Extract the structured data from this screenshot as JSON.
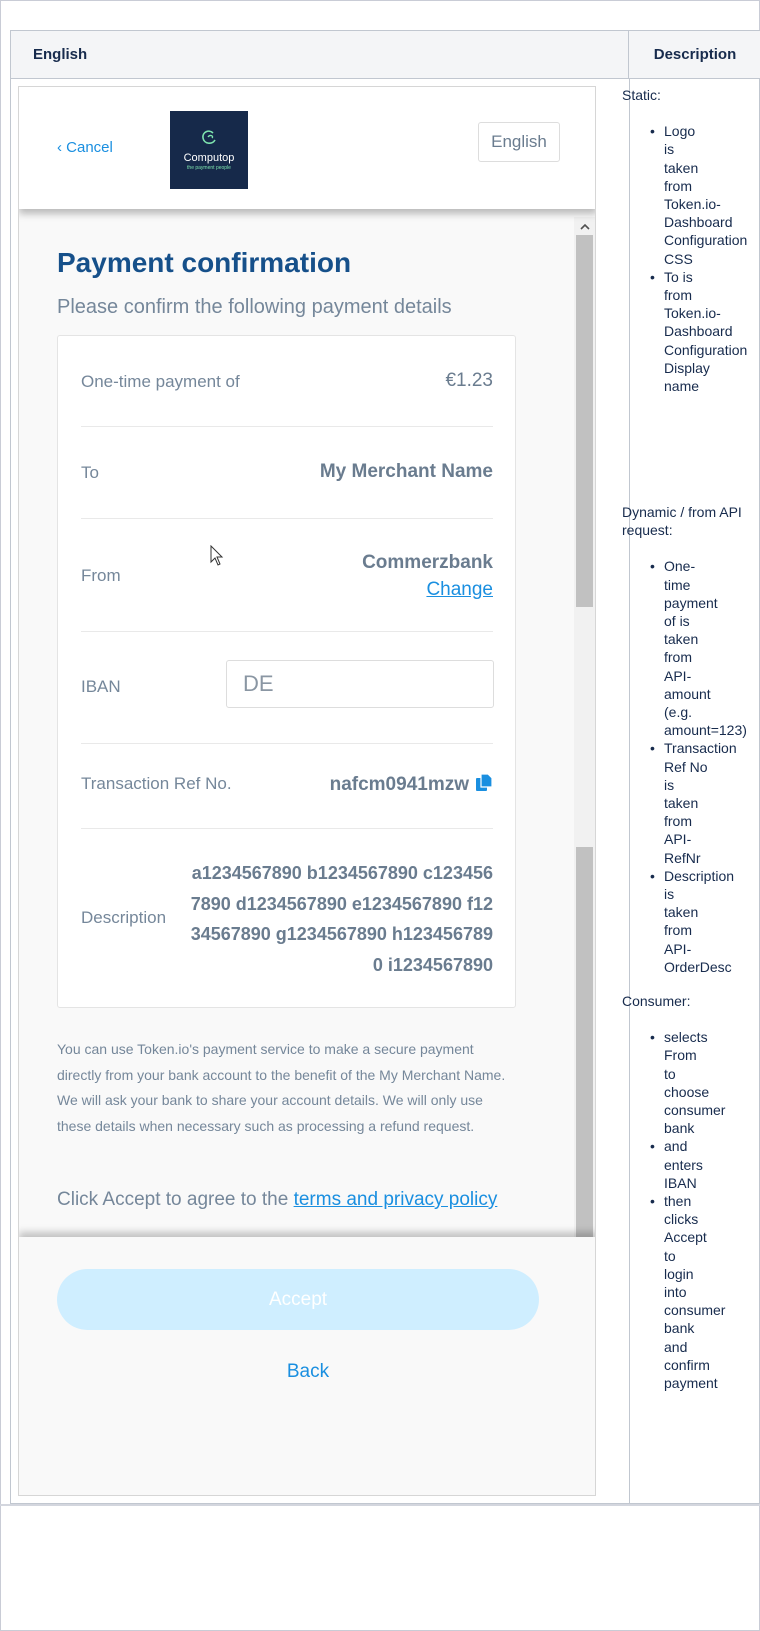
{
  "table": {
    "col1_header": "English",
    "col2_header": "Description"
  },
  "phone": {
    "cancel_label": "‹ Cancel",
    "logo": {
      "name": "Computop",
      "tagline": "the payment people"
    },
    "language": "English",
    "title": "Payment confirmation",
    "subtitle": "Please confirm the following payment details",
    "details": {
      "amount": {
        "label": "One-time payment of",
        "value": "€1.23"
      },
      "to": {
        "label": "To",
        "value": "My Merchant Name"
      },
      "from": {
        "label": "From",
        "value": "Commerzbank",
        "action": "Change"
      },
      "iban": {
        "label": "IBAN",
        "value": "DE"
      },
      "ref": {
        "label": "Transaction Ref No.",
        "value": "nafcm0941mzw"
      },
      "description": {
        "label": "Description",
        "value": "a1234567890 b1234567890 c1234567890 d1234567890 e1234567890 f1234567890 g1234567890 h1234567890 i1234567890"
      }
    },
    "info_line1": "You can use Token.io's payment service to make a secure payment directly from your bank account to the benefit of the My Merchant Name.",
    "info_line2": "We will ask your bank to share your account details. We will only use these details when necessary such as processing a refund request.",
    "terms_prefix": "Click Accept to agree to the ",
    "terms_link": "terms and privacy policy",
    "accept_label": "Accept",
    "back_label": "Back"
  },
  "description_column": {
    "static": {
      "heading": "Static:",
      "items": [
        "Logo is taken from Token.io-Dashboard Configuration CSS",
        "To is from Token.io-Dashboard Configuration Display name"
      ]
    },
    "dynamic": {
      "heading": "Dynamic / from API request:",
      "items": [
        "One-time payment of is taken from API-amount (e.g. amount=123)",
        "Transaction Ref No is taken from API-RefNr",
        "Description is taken from API-OrderDesc"
      ]
    },
    "consumer": {
      "heading": "Consumer:",
      "items": [
        "selects From to choose consumer bank",
        "and enters IBAN",
        "then clicks Accept to login into consumer bank and confirm payment"
      ]
    }
  },
  "colors": {
    "title": "#16508a",
    "link": "#1a8fe0",
    "accept_disabled": "#cfeeff"
  }
}
